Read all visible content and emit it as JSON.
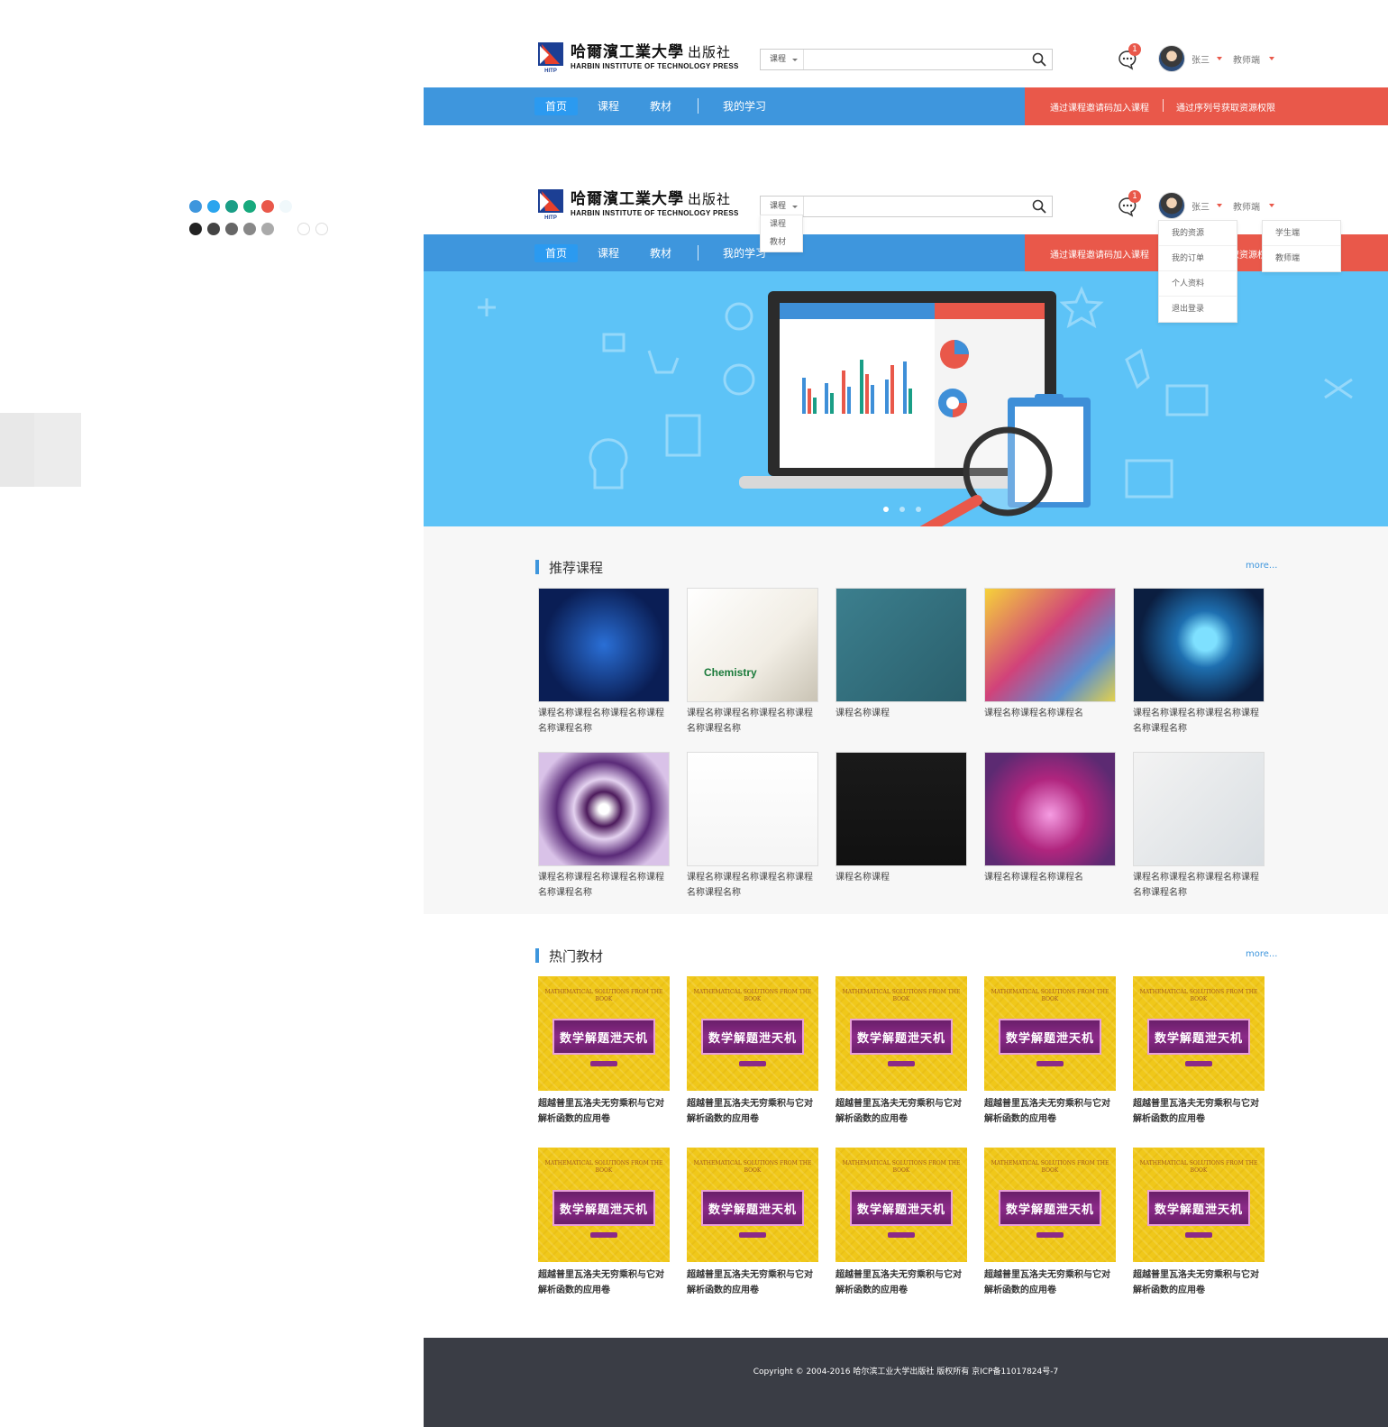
{
  "palette": {
    "row1": [
      "#3e96dd",
      "#2aa5ee",
      "#1a9e86",
      "#17a97d",
      "#e9584a",
      "#f0f8fb"
    ],
    "row2": [
      "#222222",
      "#444444",
      "#666666",
      "#888888",
      "#aaaaaa"
    ]
  },
  "header": {
    "logo_cn": "哈爾濱工業大學",
    "logo_press": "出版社",
    "logo_en": "HARBIN INSTITUTE OF TECHNOLOGY PRESS",
    "logo_mark": "HITP",
    "search_type": "课程",
    "search_icon": "search-icon",
    "message_icon": "chat-bubble-icon",
    "badge_count": "1",
    "user_name": "张三",
    "role": "教师端"
  },
  "nav": {
    "items": [
      "首页",
      "课程",
      "教材",
      "我的学习"
    ],
    "red_links": [
      "通过课程邀请码加入课程",
      "通过序列号获取资源权限"
    ],
    "accent_blue": "#3e96dd",
    "accent_red": "#e9584a"
  },
  "search_dropdown": [
    "课程",
    "教材"
  ],
  "user_menu": [
    "我的资源",
    "我的订单",
    "个人资料",
    "退出登录"
  ],
  "role_menu": [
    "学生端",
    "教师端"
  ],
  "recommend": {
    "title": "推荐课程",
    "more": "more...",
    "courses": [
      {
        "name": "课程名称课程名称课程名称课程名称课程名称",
        "image": "dna-helix"
      },
      {
        "name": "课程名称课程名称课程名称课程名称课程名称",
        "image": "chemistry-hexagons"
      },
      {
        "name": "课程名称课程",
        "image": "chalkboard-charts"
      },
      {
        "name": "课程名称课程名称课程名",
        "image": "colorful-compass"
      },
      {
        "name": "课程名称课程名称课程名称课程名称课程名称",
        "image": "blue-flower"
      },
      {
        "name": "课程名称课程名称课程名称课程名称课程名称",
        "image": "fractal-spiral"
      },
      {
        "name": "课程名称课程名称课程名称课程名称课程名称",
        "image": "geometry-girl"
      },
      {
        "name": "课程名称课程",
        "image": "blackboard-formulas"
      },
      {
        "name": "课程名称课程名称课程名",
        "image": "pink-liquid-beaker"
      },
      {
        "name": "课程名称课程名称课程名称课程名称课程名称",
        "image": "3d-letters"
      }
    ]
  },
  "hot_books": {
    "title": "热门教材",
    "more": "more...",
    "cover_title": "数学解题泄天机",
    "cover_en": "MATHEMATICAL SOLUTIONS FROM THE BOOK",
    "books": [
      "超越普里瓦洛夫无穷乘积与它对解析函数的应用卷",
      "超越普里瓦洛夫无穷乘积与它对解析函数的应用卷",
      "超越普里瓦洛夫无穷乘积与它对解析函数的应用卷",
      "超越普里瓦洛夫无穷乘积与它对解析函数的应用卷",
      "超越普里瓦洛夫无穷乘积与它对解析函数的应用卷",
      "超越普里瓦洛夫无穷乘积与它对解析函数的应用卷",
      "超越普里瓦洛夫无穷乘积与它对解析函数的应用卷",
      "超越普里瓦洛夫无穷乘积与它对解析函数的应用卷",
      "超越普里瓦洛夫无穷乘积与它对解析函数的应用卷",
      "超越普里瓦洛夫无穷乘积与它对解析函数的应用卷"
    ]
  },
  "footer": {
    "copyright": "Copyright © 2004-2016 哈尔滨工业大学出版社  版权所有    京ICP备11017824号-7"
  }
}
